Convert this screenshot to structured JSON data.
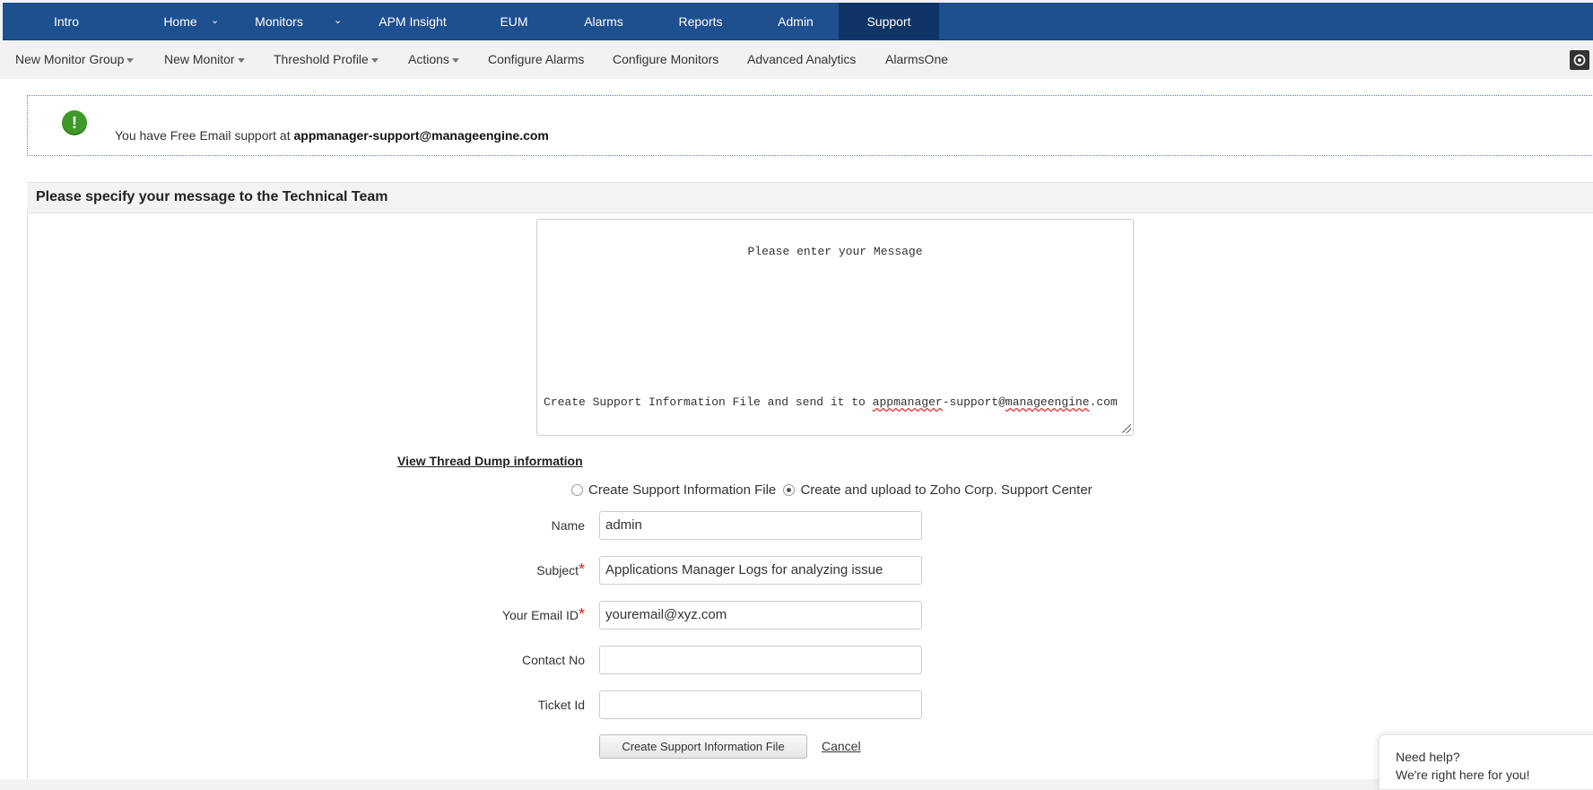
{
  "topnav": {
    "tabs": [
      {
        "label": "Intro"
      },
      {
        "label": "Home"
      },
      {
        "label": "Monitors"
      },
      {
        "label": "APM Insight"
      },
      {
        "label": "EUM"
      },
      {
        "label": "Alarms"
      },
      {
        "label": "Reports"
      },
      {
        "label": "Admin"
      },
      {
        "label": "Support"
      }
    ],
    "active_tab": "Support",
    "chevron": "⌄"
  },
  "subnav": {
    "items": [
      {
        "label": "New Monitor Group"
      },
      {
        "label": "New Monitor"
      },
      {
        "label": "Threshold Profile"
      },
      {
        "label": "Actions"
      },
      {
        "label": "Configure Alarms"
      },
      {
        "label": "Configure Monitors"
      },
      {
        "label": "Advanced Analytics"
      },
      {
        "label": "AlarmsOne"
      }
    ],
    "settings_icon": "refresh-settings-icon"
  },
  "notice": {
    "icon": "exclamation-icon",
    "text": "You have Free Email support at",
    "email": "appmanager-support@manageengine.com"
  },
  "section": {
    "title": "Please specify your message to the Technical Team"
  },
  "message": {
    "placeholder": "Please enter your Message",
    "footer_prefix": "Create Support Information File and send it to ",
    "footer_w1": "appmanager",
    "footer_w2": "-support@",
    "footer_w3": "manageengine",
    "footer_w4": ".com"
  },
  "thread_dump_link": "View Thread Dump information",
  "options": {
    "create_file": "Create Support Information File",
    "upload_zoho": "Create and upload to Zoho Corp. Support Center",
    "selected": "upload_zoho"
  },
  "form": {
    "name_label": "Name",
    "name_value": "admin",
    "subject_label": "Subject",
    "subject_value": "Applications Manager Logs for analyzing issue",
    "email_label": "Your Email ID",
    "email_value": "youremail@xyz.com",
    "contact_label": "Contact No",
    "contact_value": "",
    "ticket_label": "Ticket Id",
    "ticket_value": "",
    "required_mark": "*"
  },
  "actions": {
    "submit_label": "Create Support Information File",
    "cancel_label": "Cancel"
  },
  "help_widget": {
    "title": "Need help?",
    "subtitle": "We're right here for you!"
  },
  "colors": {
    "nav_bg": "#1e4f8f",
    "nav_active": "#0f3567",
    "notice_icon": "#3f9a2a",
    "required": "#e02020"
  }
}
